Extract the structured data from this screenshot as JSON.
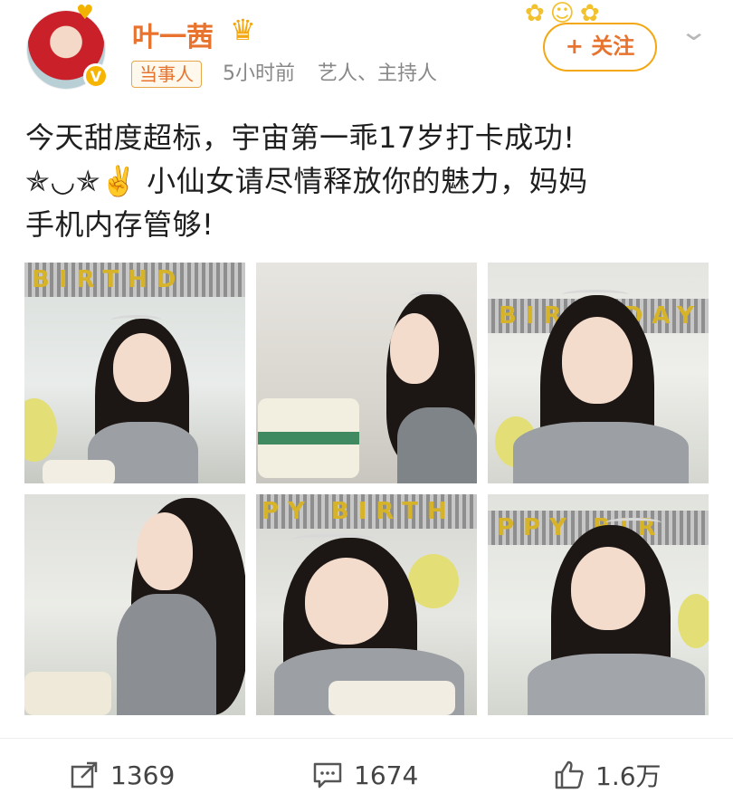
{
  "author": {
    "name": "叶一茜",
    "tag": "当事人",
    "time": "5小时前",
    "description": "艺人、主持人",
    "follow_label": "+ 关注"
  },
  "post": {
    "lines": [
      "今天甜度超标，宇宙第一乖17岁打卡成功!",
      "✯◡✯✌️ 小仙女请尽情释放你的魅力，妈妈",
      "手机内存管够!"
    ]
  },
  "photos": {
    "banner_texts": [
      "BIRTHD",
      "BIRTHDAY",
      "PY BIRTH",
      "PPY BIR"
    ]
  },
  "actions": {
    "share_count": "1369",
    "comment_count": "1674",
    "like_count": "1.6万"
  },
  "colors": {
    "accent": "#e8732e",
    "gold": "#f3a713",
    "text": "#1f1f1f",
    "muted": "#888888"
  },
  "icons": {
    "share": "share-icon",
    "comment": "comment-icon",
    "like": "like-icon",
    "crown": "crown-icon",
    "verified": "verified-badge-icon",
    "more": "chevron-down-icon"
  }
}
